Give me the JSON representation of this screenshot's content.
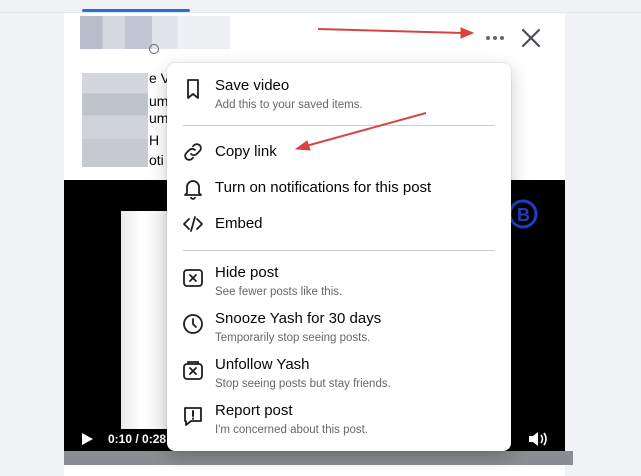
{
  "colors": {
    "accent": "#1b74e4",
    "annotation_arrow": "#d64541",
    "menu_text": "#050505",
    "menu_subtext": "#65676b"
  },
  "post": {
    "text_fragments": [
      "e V",
      "um",
      "um",
      "H",
      "oti"
    ]
  },
  "header": {
    "more_icon": "more-horizontal-icon",
    "close_icon": "close-icon"
  },
  "video": {
    "time": "0:10 / 0:28"
  },
  "menu": {
    "items": [
      {
        "title": "Save video",
        "subtitle": "Add this to your saved items.",
        "icon": "bookmark-icon"
      },
      {
        "title": "Copy link",
        "subtitle": "",
        "icon": "link-icon"
      },
      {
        "title": "Turn on notifications for this post",
        "subtitle": "",
        "icon": "bell-icon"
      },
      {
        "title": "Embed",
        "subtitle": "",
        "icon": "code-icon"
      },
      {
        "title": "Hide post",
        "subtitle": "See fewer posts like this.",
        "icon": "hide-box-icon"
      },
      {
        "title": "Snooze Yash for 30 days",
        "subtitle": "Temporarily stop seeing posts.",
        "icon": "clock-icon"
      },
      {
        "title": "Unfollow Yash",
        "subtitle": "Stop seeing posts but stay friends.",
        "icon": "unfollow-icon"
      },
      {
        "title": "Report post",
        "subtitle": "I'm concerned about this post.",
        "icon": "report-icon"
      }
    ]
  }
}
